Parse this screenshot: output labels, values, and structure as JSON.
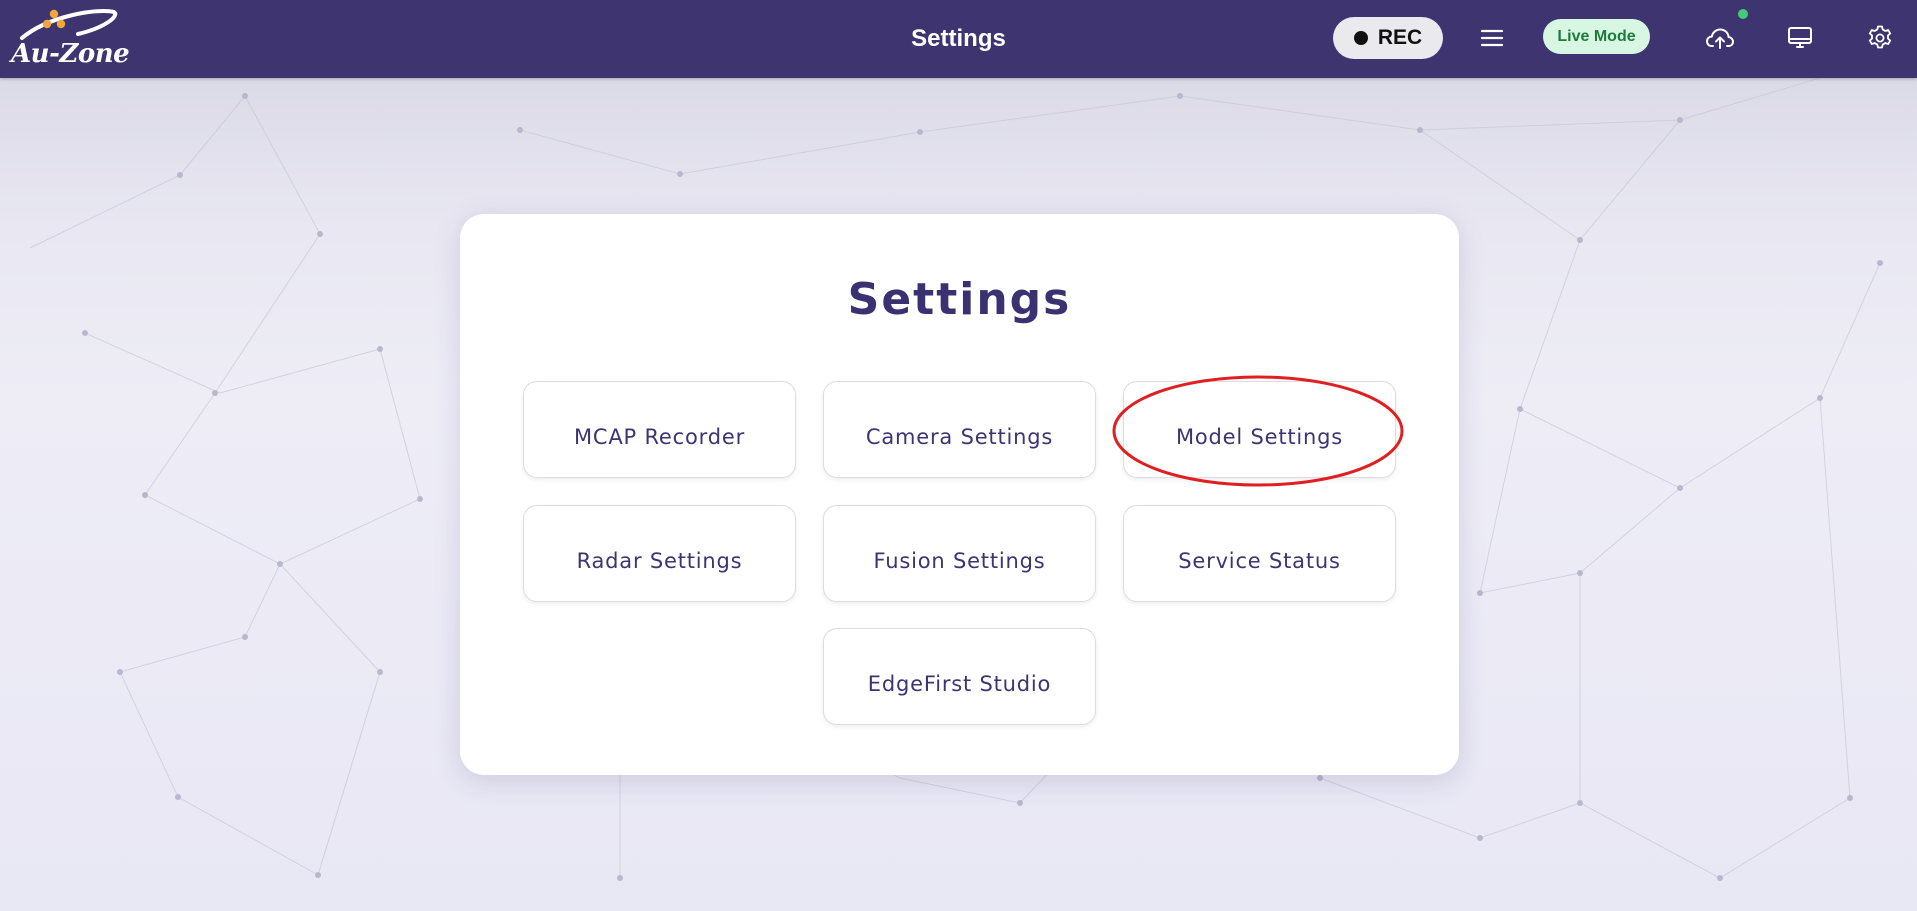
{
  "header": {
    "logo_text": "Au-Zone",
    "title": "Settings",
    "rec_label": "REC",
    "live_mode_label": "Live Mode",
    "icons": [
      "menu-icon",
      "cloud-upload-icon",
      "monitor-icon",
      "gear-icon"
    ],
    "status_color": "#46c97a"
  },
  "main": {
    "title": "Settings",
    "tiles": [
      {
        "label": "MCAP Recorder"
      },
      {
        "label": "Camera Settings"
      },
      {
        "label": "Model Settings"
      },
      {
        "label": "Radar Settings"
      },
      {
        "label": "Fusion Settings"
      },
      {
        "label": "Service Status"
      },
      {
        "label": "EdgeFirst Studio"
      }
    ]
  },
  "colors": {
    "header_bg": "#3e3470",
    "accent_text": "#3a3270",
    "live_mode_bg": "#d8f7e3",
    "annotation": "#e02020"
  }
}
